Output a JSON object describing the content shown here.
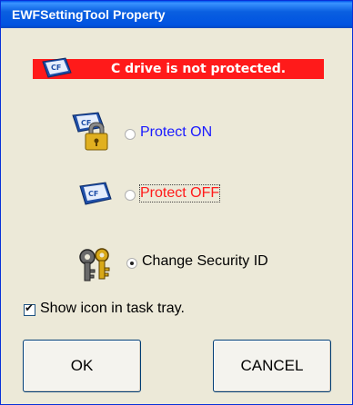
{
  "window": {
    "title": "EWFSettingTool Property"
  },
  "status": {
    "text": "C drive is not protected.",
    "color": "#ff1a1a",
    "icon": "cf-card-icon"
  },
  "options": [
    {
      "label": "Protect ON",
      "checked": false,
      "icon": "cf-lock-icon",
      "color": "#1a1aff"
    },
    {
      "label": "Protect OFF",
      "checked": false,
      "icon": "cf-card-icon",
      "color": "#ff1a1a"
    },
    {
      "label": "Change Security ID",
      "checked": true,
      "icon": "keys-icon",
      "color": "#000000"
    }
  ],
  "show_tray": {
    "label": "Show icon in task tray.",
    "checked": true
  },
  "buttons": {
    "ok": "OK",
    "cancel": "CANCEL"
  }
}
